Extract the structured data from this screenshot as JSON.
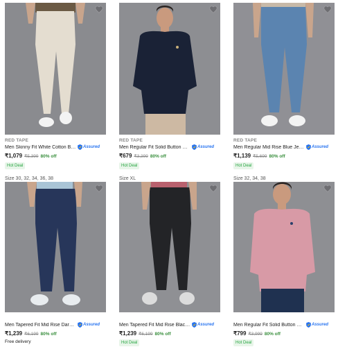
{
  "colors": {
    "accent": "#2874f0",
    "discount": "#388e3c",
    "hot_deal": "#26a541"
  },
  "products": [
    {
      "brand": "RED TAPE",
      "title": "Men Skinny Fit White Cotton Ble...",
      "assured": "Assured",
      "price": "₹1,079",
      "mrp": "₹5,399",
      "discount": "80% off",
      "badge": "Hot Deal",
      "wishlist_icon": "heart-icon"
    },
    {
      "brand": "RED TAPE",
      "title": "Men Regular Fit Solid Button Do...",
      "assured": "Assured",
      "price": "₹679",
      "mrp": "₹3,399",
      "discount": "80% off",
      "badge": "Hot Deal",
      "wishlist_icon": "heart-icon"
    },
    {
      "brand": "RED TAPE",
      "title": "Men Regular Mid Rise Blue Jeans",
      "assured": "Assured",
      "price": "₹1,139",
      "mrp": "₹5,699",
      "discount": "80% off",
      "badge": "Hot Deal",
      "wishlist_icon": "heart-icon"
    },
    {
      "sizes": "Size 30, 32, 34, 36, 38",
      "brand": "",
      "title": "Men Tapered Fit Mid Rise Dark B...",
      "assured": "Assured",
      "price": "₹1,239",
      "mrp": "₹6,199",
      "discount": "80% off",
      "delivery": "Free delivery",
      "wishlist_icon": "heart-icon"
    },
    {
      "sizes": "Size XL",
      "brand": "",
      "title": "Men Tapered Fit Mid Rise Black ...",
      "assured": "Assured",
      "price": "₹1,239",
      "mrp": "₹6,199",
      "discount": "80% off",
      "badge": "Hot Deal",
      "wishlist_icon": "heart-icon"
    },
    {
      "sizes": "Size 32, 34, 38",
      "brand": "",
      "title": "Men Regular Fit Solid Button Do...",
      "assured": "Assured",
      "price": "₹799",
      "mrp": "₹3,999",
      "discount": "80% off",
      "badge": "Hot Deal",
      "wishlist_icon": "heart-icon"
    }
  ]
}
